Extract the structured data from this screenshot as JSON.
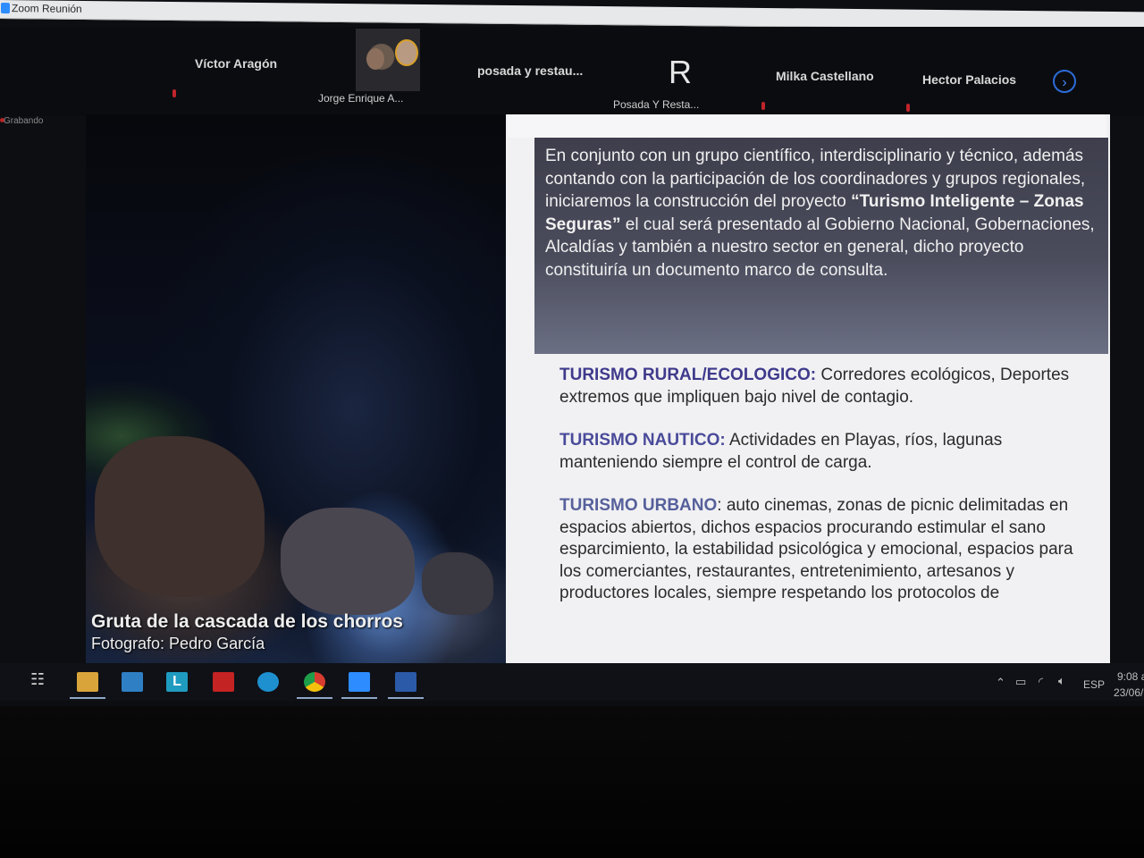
{
  "window": {
    "title": "Zoom Reunión"
  },
  "participants": [
    {
      "name": "Víctor Aragón"
    },
    {
      "name": "Jorge Enrique A..."
    },
    {
      "name": "posada y restau..."
    },
    {
      "name": "Posada Y Resta...",
      "avatar_letter": "R"
    },
    {
      "name": "Milka Castellano"
    },
    {
      "name": "Hector Palacios"
    }
  ],
  "recording": {
    "label": "Grabando"
  },
  "photo": {
    "caption_title": "Gruta de la cascada de los chorros",
    "caption_credit": "Fotografo: Pedro García"
  },
  "slide": {
    "intro_part1": "En conjunto con un grupo científico, interdisciplinario y técnico, además contando con la participación de los coordinadores y grupos regionales, iniciaremos la construcción del proyecto",
    "intro_bold": "“Turismo Inteligente – Zonas Seguras”",
    "intro_part2": "el cual será presentado al Gobierno Nacional, Gobernaciones, Alcaldías y también a nuestro sector en general, dicho proyecto constituiría un documento marco de consulta.",
    "items": [
      {
        "heading": "TURISMO RURAL/ECOLOGICO:",
        "text": "Corredores ecológicos, Deportes extremos que impliquen bajo nivel de contagio."
      },
      {
        "heading": "TURISMO NAUTICO:",
        "text": "Actividades en Playas, ríos, lagunas manteniendo siempre el control de carga."
      },
      {
        "heading": "TURISMO URBANO",
        "text": ": auto cinemas, zonas de picnic delimitadas en espacios abiertos, dichos espacios procurando estimular el sano esparcimiento, la estabilidad psicológica y emocional, espacios para los comerciantes, restaurantes, entretenimiento, artesanos y productores locales, siempre respetando los protocolos de"
      }
    ]
  },
  "taskbar": {
    "icons": [
      "task-view-icon",
      "file-explorer-icon",
      "mail-icon",
      "l-app-icon",
      "red-app-icon",
      "edge-icon",
      "chrome-icon",
      "zoom-icon",
      "word-icon"
    ],
    "language": "ESP",
    "time": "9:08 a",
    "date": "23/06/"
  }
}
